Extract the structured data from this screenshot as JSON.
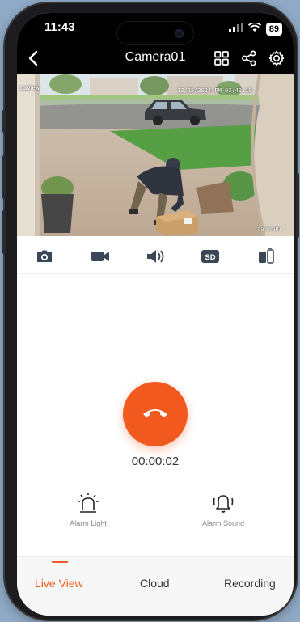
{
  "status_bar": {
    "time": "11:43",
    "battery": "89"
  },
  "header": {
    "title": "Camera01",
    "back_icon": "chevron-left-icon",
    "actions": [
      "grid-icon",
      "share-icon",
      "gear-icon"
    ]
  },
  "video": {
    "logo_text": "LaView",
    "timestamp": "12/25/2024 PM 02:43:10",
    "watermark": "Camera01"
  },
  "controls": [
    "camera-icon",
    "video-icon",
    "speaker-icon",
    "sd-icon",
    "mirror-icon"
  ],
  "controls_sd_label": "SD",
  "call": {
    "timer": "00:00:02",
    "icon": "hang-up-icon"
  },
  "alarms": {
    "light_label": "Alarm Light",
    "sound_label": "Alarm Sound"
  },
  "tabs": [
    {
      "label": "Live View",
      "active": true
    },
    {
      "label": "Cloud",
      "active": false
    },
    {
      "label": "Recording",
      "active": false
    }
  ],
  "colors": {
    "accent": "#f2591f"
  }
}
